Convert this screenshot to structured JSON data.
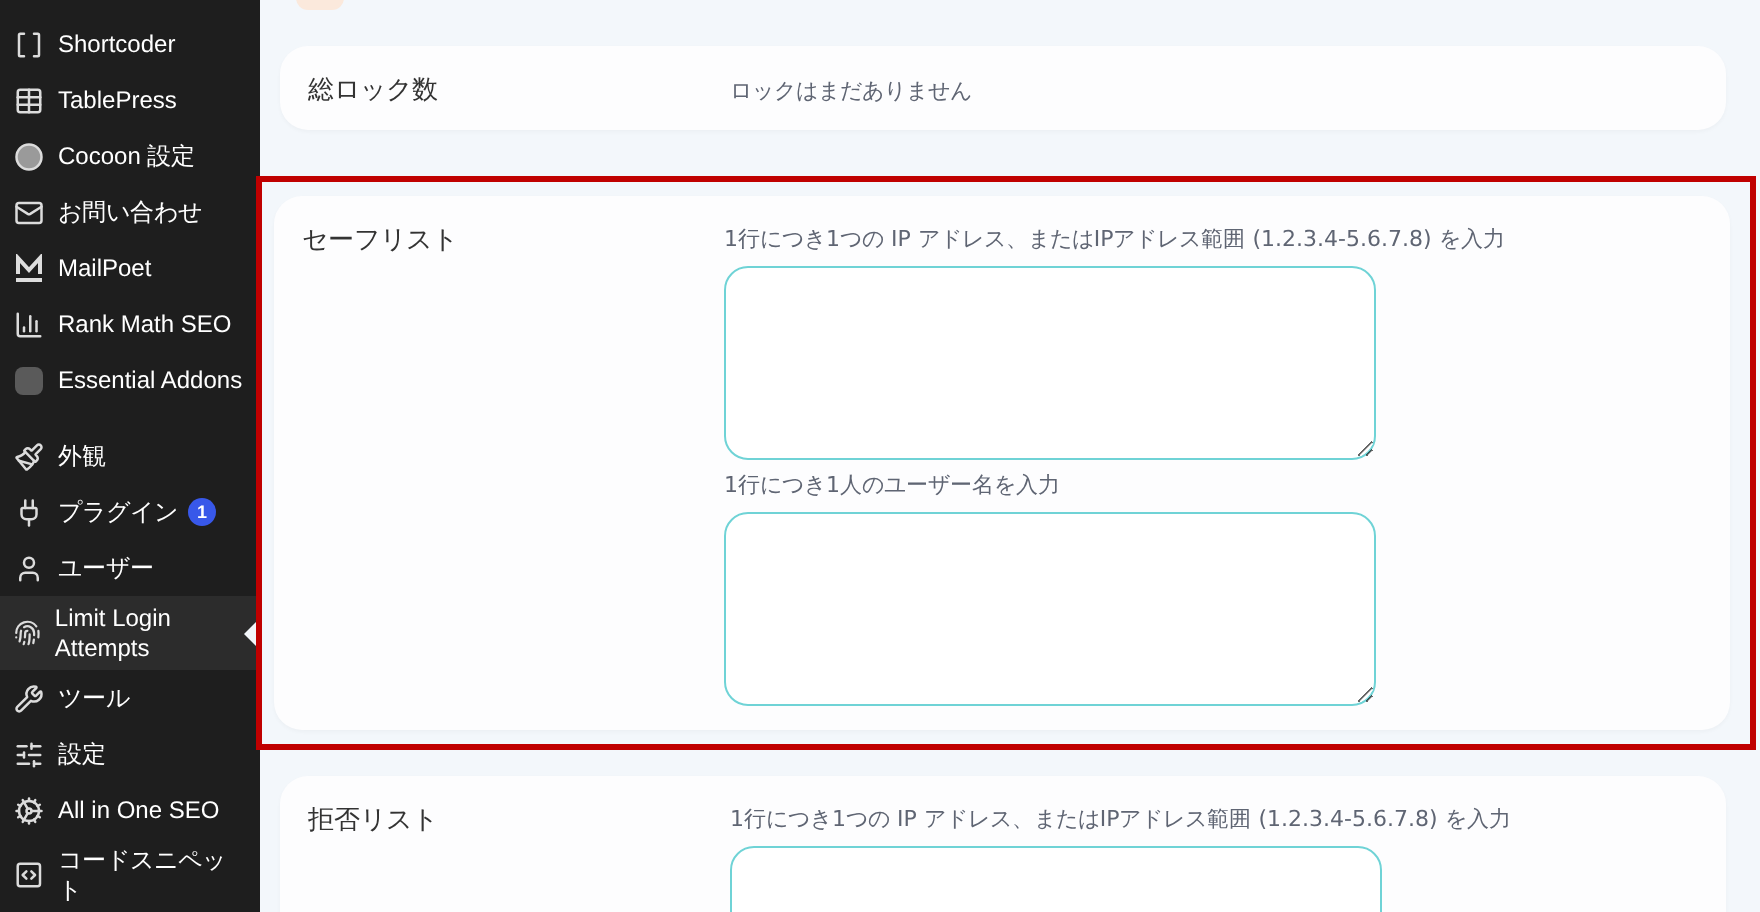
{
  "sidebar": {
    "items": [
      {
        "label": "Shortcoder",
        "selected": false
      },
      {
        "label": "TablePress",
        "selected": false
      },
      {
        "label": "Cocoon 設定",
        "selected": false
      },
      {
        "label": "お問い合わせ",
        "selected": false
      },
      {
        "label": "MailPoet",
        "selected": false
      },
      {
        "label": "Rank Math SEO",
        "selected": false
      },
      {
        "label": "Essential Addons",
        "selected": false
      },
      {
        "label": "外観",
        "selected": false
      },
      {
        "label": "プラグイン",
        "selected": false,
        "badge": "1"
      },
      {
        "label": "ユーザー",
        "selected": false
      },
      {
        "label": "Limit Login Attempts",
        "selected": true
      },
      {
        "label": "ツール",
        "selected": false
      },
      {
        "label": "設定",
        "selected": false
      },
      {
        "label": "All in One SEO",
        "selected": false
      },
      {
        "label": "コードスニペット",
        "selected": false
      }
    ]
  },
  "sections": [
    {
      "title": "総ロック数",
      "highlighted": false,
      "kind": "text",
      "value": "ロックはまだありません"
    },
    {
      "title": "セーフリスト",
      "highlighted": true,
      "kind": "fields",
      "fields": [
        {
          "hint": "1行につき1つの IP アドレス、またはIPアドレス範囲 (1.2.3.4-5.6.7.8) を入力"
        },
        {
          "hint": "1行につき1人のユーザー名を入力"
        }
      ]
    },
    {
      "title": "拒否リスト",
      "highlighted": false,
      "kind": "fields",
      "fields": [
        {
          "hint": "1行につき1つの IP アドレス、またはIPアドレス範囲 (1.2.3.4-5.6.7.8) を入力"
        }
      ]
    }
  ]
}
